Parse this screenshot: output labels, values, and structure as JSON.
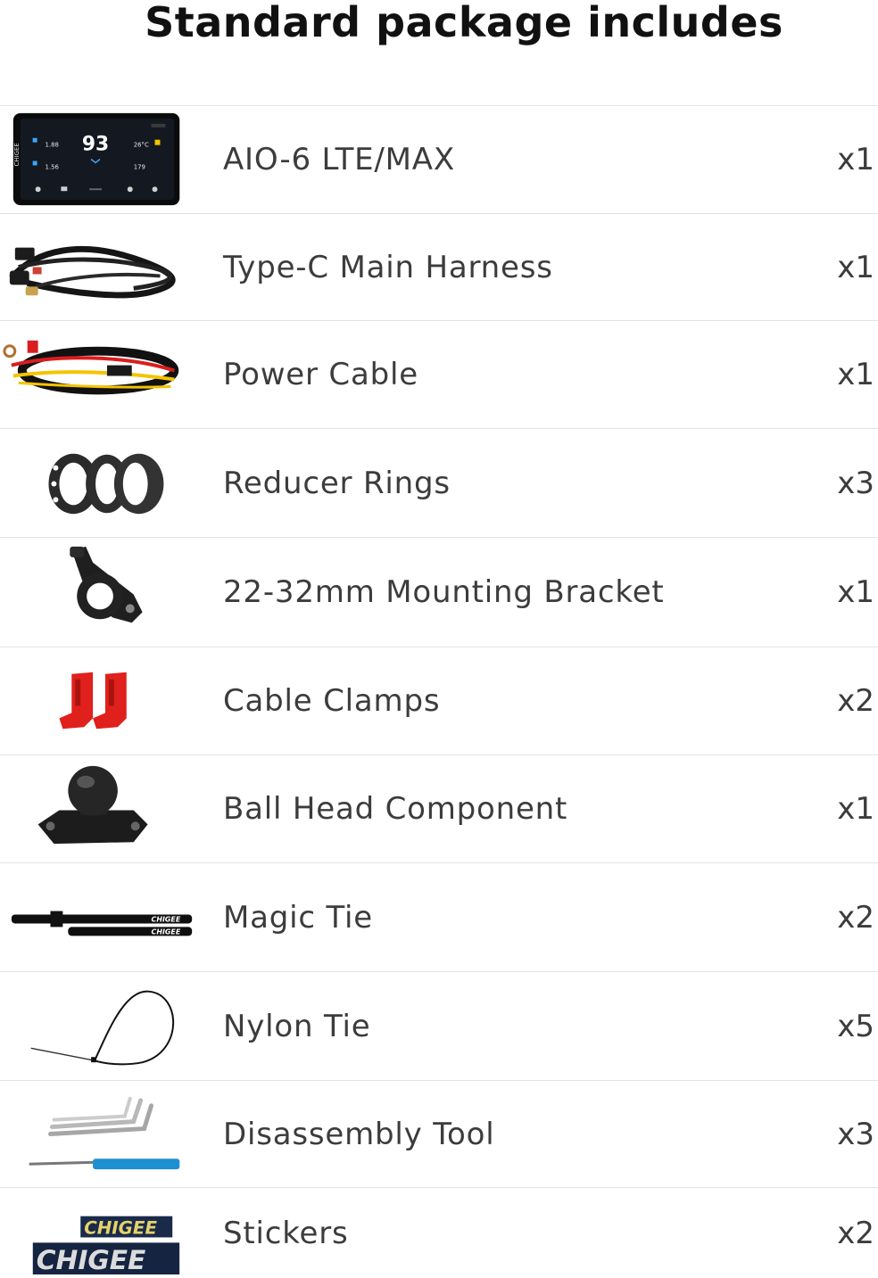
{
  "title": "Standard package includes",
  "items": [
    {
      "name": "AIO-6 LTE/MAX",
      "qty": "x1",
      "icon": "display-device-icon",
      "screen": {
        "speed": "93",
        "left_top": "1.88",
        "left_bottom": "1.56",
        "temp": "26°C",
        "right_bottom": "179",
        "brand": "CHIGEE"
      }
    },
    {
      "name": "Type-C Main Harness",
      "qty": "x1",
      "icon": "main-harness-icon"
    },
    {
      "name": "Power Cable",
      "qty": "x1",
      "icon": "power-cable-icon"
    },
    {
      "name": "Reducer Rings",
      "qty": "x3",
      "icon": "reducer-rings-icon"
    },
    {
      "name": "22-32mm Mounting Bracket",
      "qty": "x1",
      "icon": "mounting-bracket-icon"
    },
    {
      "name": "Cable Clamps",
      "qty": "x2",
      "icon": "cable-clamps-icon"
    },
    {
      "name": "Ball Head Component",
      "qty": "x1",
      "icon": "ball-head-icon"
    },
    {
      "name": "Magic Tie",
      "qty": "x2",
      "icon": "magic-tie-icon",
      "label": "CHIGEE"
    },
    {
      "name": "Nylon Tie",
      "qty": "x5",
      "icon": "nylon-tie-icon"
    },
    {
      "name": "Disassembly Tool",
      "qty": "x3",
      "icon": "disassembly-tool-icon"
    },
    {
      "name": "Stickers",
      "qty": "x2",
      "icon": "stickers-icon",
      "label": "CHIGEE"
    }
  ],
  "colors": {
    "text": "#3c3c3c",
    "title": "#111111",
    "divider": "#e2e2e2",
    "clamp_red": "#e0201c",
    "cable_yellow": "#f5c400",
    "cable_red": "#d81e1e",
    "tool_blue": "#1e8fd0"
  }
}
